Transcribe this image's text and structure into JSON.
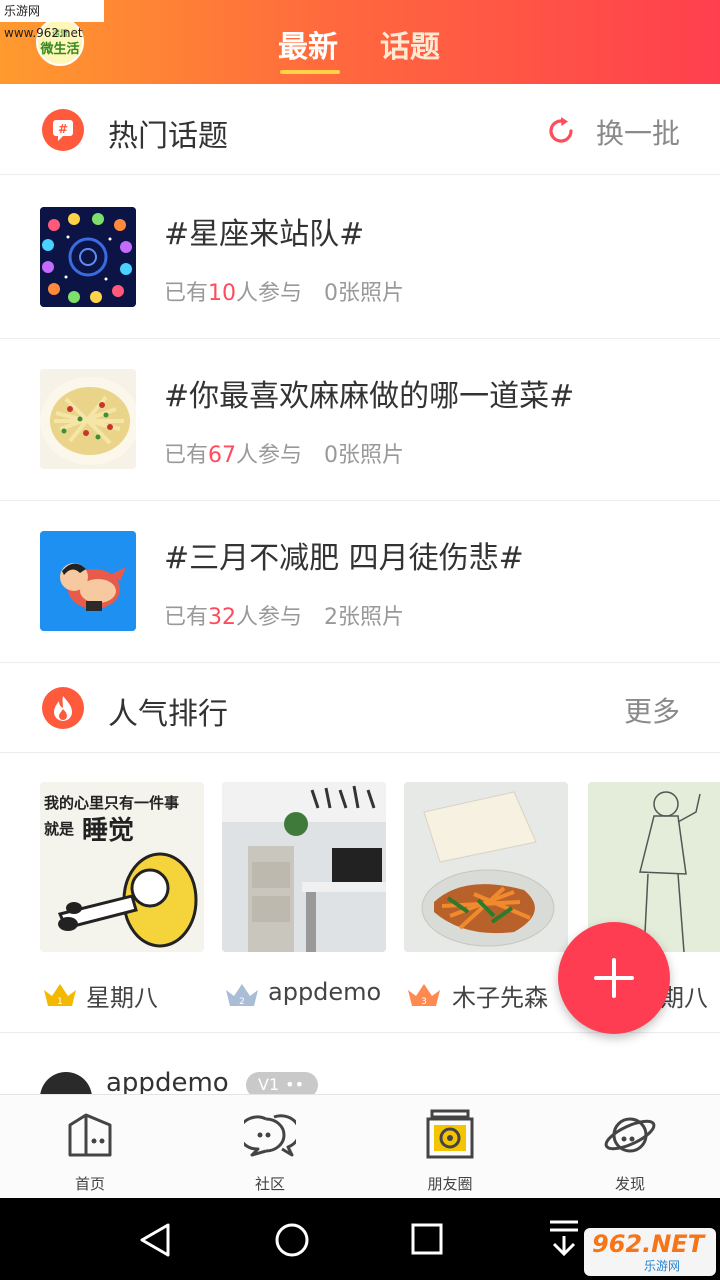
{
  "watermark": "乐游网 www.962.net",
  "header": {
    "logo_top": "诸暨",
    "logo_main": "微生活",
    "tabs": [
      {
        "label": "最新"
      },
      {
        "label": "话题"
      }
    ]
  },
  "hot_topics": {
    "title": "热门话题",
    "refresh_label": "换一批",
    "items": [
      {
        "title": "#星座来站队#",
        "prefix": "已有",
        "count": "10",
        "suffix": "人参与",
        "photos": "0张照片"
      },
      {
        "title": "#你最喜欢麻麻做的哪一道菜#",
        "prefix": "已有",
        "count": "67",
        "suffix": "人参与",
        "photos": "0张照片"
      },
      {
        "title": "#三月不减肥 四月徒伤悲#",
        "prefix": "已有",
        "count": "32",
        "suffix": "人参与",
        "photos": "2张照片"
      }
    ]
  },
  "ranking": {
    "title": "人气排行",
    "more_label": "更多",
    "card1_text_line1": "我的心里只有一件事",
    "card1_text_line2": "就是",
    "card1_text_big": "睡觉",
    "users": [
      {
        "name": "星期八",
        "rank": "1",
        "crown_color": "#f5b800"
      },
      {
        "name": "appdemo",
        "rank": "2",
        "crown_color": "#a9bed6"
      },
      {
        "name": "木子先森",
        "rank": "3",
        "crown_color": "#ff8a50"
      },
      {
        "name": "期八"
      }
    ]
  },
  "feed": {
    "username": "appdemo",
    "level": "V1"
  },
  "bottom_nav": [
    {
      "label": "首页",
      "icon": "home-icon"
    },
    {
      "label": "社区",
      "icon": "chat-bubbles-icon"
    },
    {
      "label": "朋友圈",
      "icon": "camera-icon"
    },
    {
      "label": "发现",
      "icon": "planet-icon"
    }
  ],
  "system_nav": [
    "back-icon",
    "home-circle-icon",
    "recent-apps-icon",
    "collapse-icon"
  ],
  "corner_badge": {
    "brand": "962.NET",
    "sub": "乐游网"
  },
  "colors": {
    "accent": "#ff3d52",
    "header_start": "#ff9a2e",
    "header_end": "#ff3f4e",
    "count": "#ff4b5c"
  }
}
